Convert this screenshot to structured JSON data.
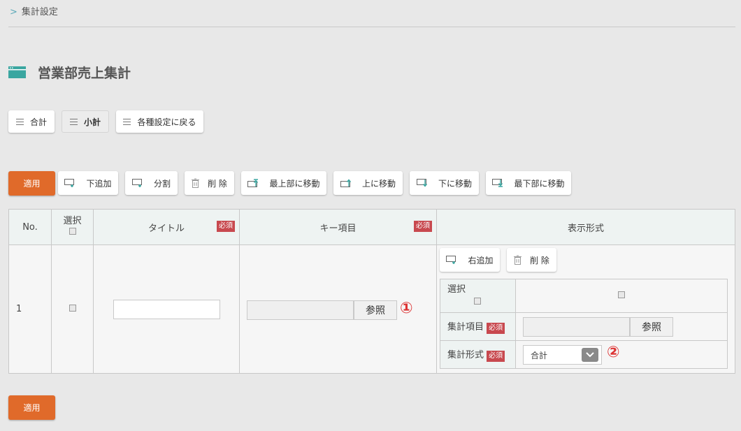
{
  "breadcrumb": {
    "label": "集計設定"
  },
  "page": {
    "title": "営業部売上集計"
  },
  "tabs": {
    "total": "合計",
    "subtotal": "小計",
    "back": "各種設定に戻る"
  },
  "toolbar": {
    "apply": "適用",
    "add_below": "下追加",
    "split": "分割",
    "delete": "削 除",
    "move_top": "最上部に移動",
    "move_up": "上に移動",
    "move_down": "下に移動",
    "move_bottom": "最下部に移動"
  },
  "table": {
    "headers": {
      "no": "No.",
      "select": "選択",
      "title": "タイトル",
      "key": "キー項目",
      "display": "表示形式"
    },
    "required": "必須",
    "row": {
      "no": "1",
      "ref_label": "参照",
      "marker1": "①"
    }
  },
  "display": {
    "add_right": "右追加",
    "delete": "削 除",
    "select_label": "選択",
    "item_label": "集計項目",
    "format_label": "集計形式",
    "ref_label": "参照",
    "format_value": "合計",
    "marker2": "②"
  },
  "footer": {
    "apply": "適用"
  },
  "colors": {
    "accent": "#e06a2a",
    "required": "#c8494f",
    "teal": "#3aa6a0"
  }
}
